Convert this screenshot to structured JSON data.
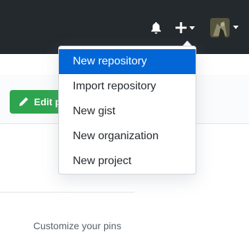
{
  "header": {
    "notifications_icon": "bell-icon",
    "create_icon": "plus-icon",
    "avatar_icon": "user-avatar",
    "background_color": "#24292e"
  },
  "create_menu": {
    "items": [
      {
        "label": "New repository",
        "active": true
      },
      {
        "label": "Import repository",
        "active": false
      },
      {
        "label": "New gist",
        "active": false
      },
      {
        "label": "New organization",
        "active": false
      },
      {
        "label": "New project",
        "active": false
      }
    ],
    "highlight_color": "#0366d6"
  },
  "profile": {
    "edit_button_label": "Edit profile",
    "edit_button_icon": "pencil-icon",
    "edit_button_color": "#2ea44f",
    "customize_pins_label": "Customize your pins"
  }
}
